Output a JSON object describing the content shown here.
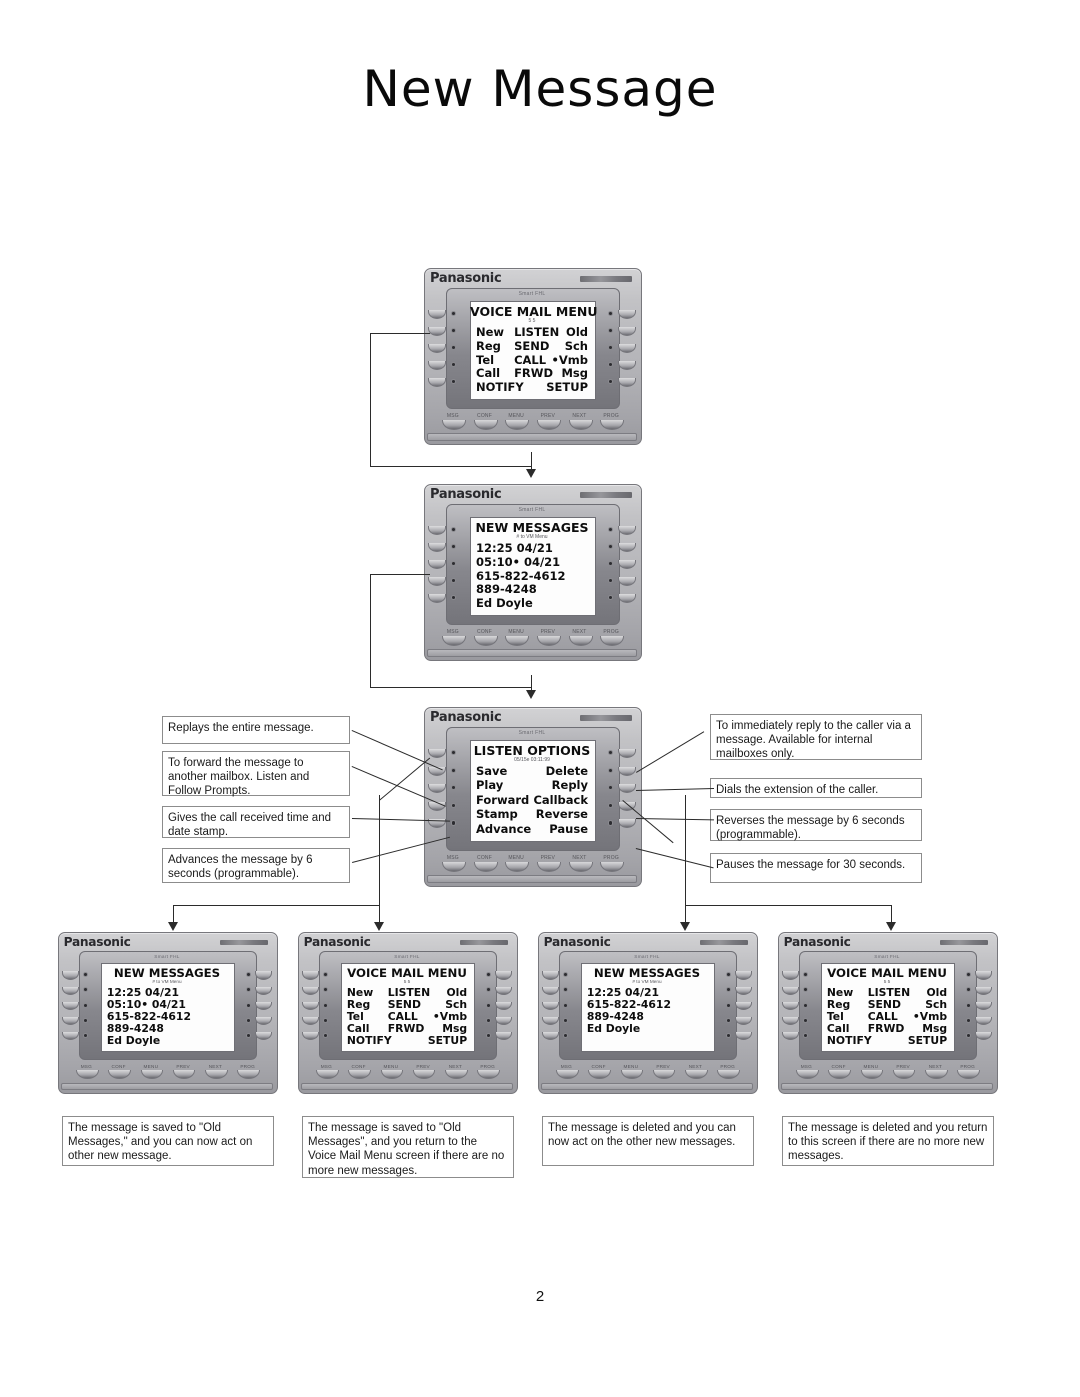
{
  "document": {
    "title": "New Message",
    "page_number": "2"
  },
  "phone_chrome": {
    "brand": "Panasonic",
    "model_strip": "Smart FHL",
    "bottom_buttons": [
      "MSG",
      "CONF",
      "MENU",
      "PREV",
      "NEXT",
      "PROG"
    ]
  },
  "screens": {
    "voice_mail_menu": {
      "title": "VOICE MAIL MENU",
      "subtitle": "5                    5",
      "rows": [
        {
          "left": "New",
          "center": "LISTEN",
          "right": "Old"
        },
        {
          "left": "Reg",
          "center": "SEND",
          "right": "Sch"
        },
        {
          "left": "Tel",
          "center": "CALL",
          "right": "•Vmb"
        },
        {
          "left": "Call",
          "center": "FRWD",
          "right": "Msg"
        },
        {
          "left": "NOTIFY",
          "center": "",
          "right": "SETUP"
        }
      ]
    },
    "new_messages_full": {
      "title": "NEW MESSAGES",
      "subtitle": "# to VM Menu",
      "rows": [
        {
          "left": "12:25 04/21"
        },
        {
          "left": "05:10• 04/21"
        },
        {
          "left": "615-822-4612"
        },
        {
          "left": "889-4248"
        },
        {
          "left": "Ed Doyle"
        }
      ]
    },
    "new_messages_short": {
      "title": "NEW MESSAGES",
      "subtitle": "# to VM Menu",
      "rows": [
        {
          "left": "12:25 04/21"
        },
        {
          "left": "615-822-4612"
        },
        {
          "left": "889-4248"
        },
        {
          "left": "Ed Doyle"
        },
        {
          "left": ""
        }
      ]
    },
    "listen_options": {
      "title": "LISTEN OPTIONS",
      "subtitle": "05/15e 03:11:99",
      "rows": [
        {
          "left": "Save",
          "right": "Delete"
        },
        {
          "left": "Play",
          "right": "Reply"
        },
        {
          "left": "Forward",
          "right": "Callback"
        },
        {
          "left": "Stamp",
          "right": "Reverse"
        },
        {
          "left": "Advance",
          "right": "Pause"
        }
      ]
    }
  },
  "callouts": {
    "left": [
      "Replays the entire message.",
      "To forward the message to another mailbox.  Listen and Follow Prompts.",
      "Gives the call received time and date stamp.",
      "Advances the message by 6 seconds (programmable)."
    ],
    "right": [
      "To immediately reply to the caller via a message.  Available for internal mailboxes only.",
      "Dials the extension of the caller.",
      "Reverses the message by 6 seconds (programmable).",
      "Pauses the message for 30 seconds."
    ],
    "bottom": [
      "The message is saved to \"Old Messages,\" and you can now act on other new message.",
      "The message is saved to \"Old Messages\", and you return to the Voice Mail Menu screen if there are no more new messages.",
      "The message is deleted and you can now act on the other new messages.",
      "The message is deleted and you return to this screen if there are no more new messages."
    ]
  },
  "colors": {
    "line": "#2b2b2b",
    "box_border": "#8c8c8c",
    "lcd_bg": "#fdfdfd"
  }
}
